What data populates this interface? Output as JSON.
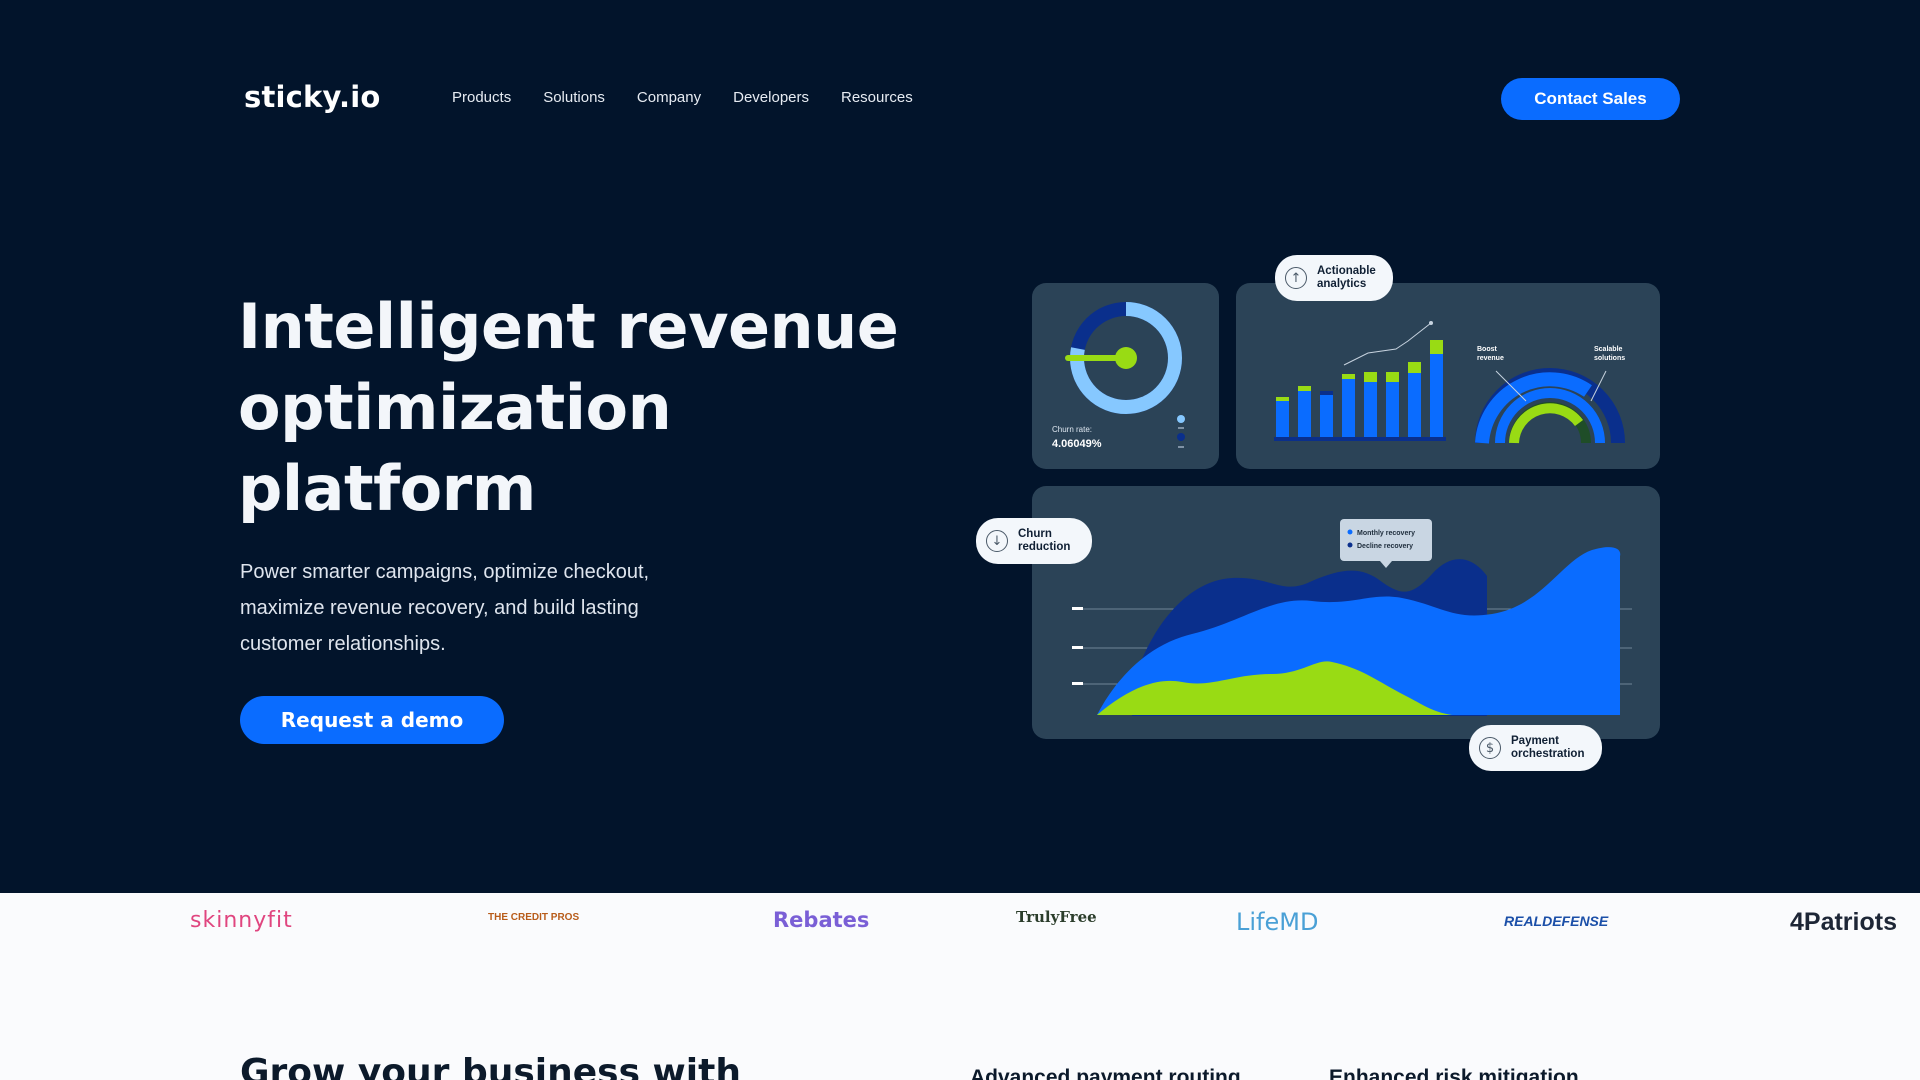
{
  "header": {
    "logo": "sticky.io",
    "nav": [
      "Products",
      "Solutions",
      "Company",
      "Developers",
      "Resources"
    ],
    "cta": "Contact Sales"
  },
  "hero": {
    "headline_lines": [
      "Intelligent revenue",
      "optimization",
      "platform"
    ],
    "subtext_lines": [
      "Power smarter campaigns, optimize checkout,",
      "maximize revenue recovery, and build lasting",
      "customer relationships."
    ],
    "demo_button": "Request a demo"
  },
  "dashboard": {
    "churn_label": "Churn rate:",
    "churn_value": "4.06049%",
    "pills": {
      "analytics": "Actionable\nanalytics",
      "churn": "Churn\nreduction",
      "payment": "Payment\norchestration"
    },
    "gauge_labels": {
      "boost": "Boost\nrevenue",
      "scalable": "Scalable\nsolutions"
    },
    "legend": [
      "Monthly recovery",
      "Decline recovery"
    ],
    "colors": {
      "light_blue": "#86c8ff",
      "blue": "#0a6cff",
      "dark_blue": "#0a2f8c",
      "green": "#99db14"
    }
  },
  "brands": [
    "skinnyfit",
    "THE CREDIT PROS",
    "Rebates",
    "TrulyFree",
    "LifeMD",
    "REALDEFENSE",
    "4Patriots"
  ],
  "lower": {
    "title": "Grow your business with",
    "features": [
      "Advanced payment routing",
      "Enhanced risk mitigation"
    ]
  }
}
